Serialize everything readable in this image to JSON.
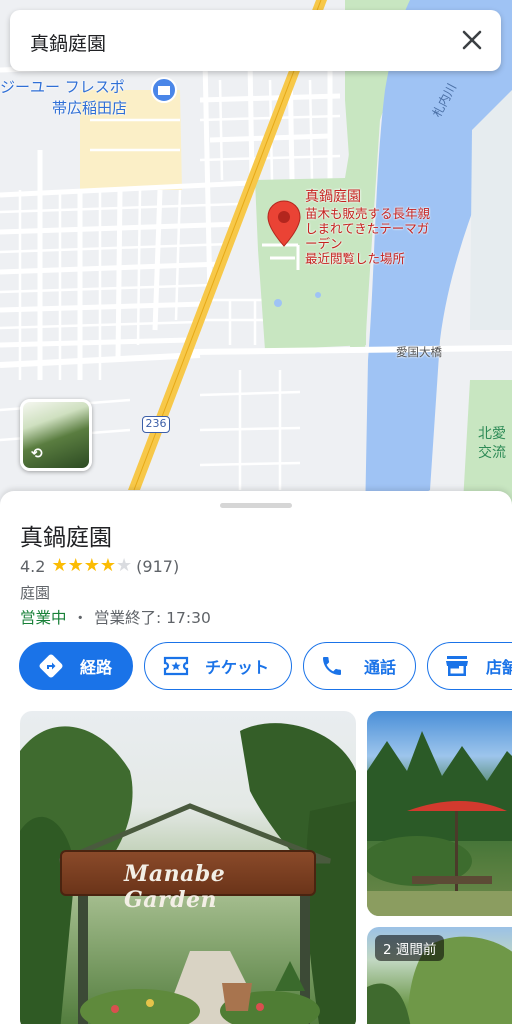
{
  "search": {
    "query": "真鍋庭園"
  },
  "map": {
    "poi": {
      "name": "真鍋庭園",
      "description_lines": [
        "苗木も販売する長年親",
        "しまれてきたテーマガ",
        "ーデン",
        "最近閲覧した場所"
      ]
    },
    "store_label_lines": [
      "ジーユー フレスポ",
      "帯広稲田店"
    ],
    "bridge_label": "愛国大橋",
    "river_label": "札内川",
    "area_label_lines": [
      "北愛",
      "交流"
    ],
    "route_number": "236"
  },
  "place": {
    "title": "真鍋庭園",
    "rating": "4.2",
    "stars_filled": 4,
    "stars_total": 5,
    "review_count": "(917)",
    "category": "庭園",
    "open_status": "営業中",
    "separator": "・",
    "close_time": "営業終了: 17:30"
  },
  "actions": {
    "route": "経路",
    "ticket": "チケット",
    "call": "通話",
    "store": "店舗"
  },
  "photos": {
    "sign_text": "Manabe Garden",
    "badge": "2 週間前"
  },
  "colors": {
    "accent": "#1a73e8",
    "open": "#188038",
    "pin": "#ea4335",
    "star": "#fbbc04"
  }
}
